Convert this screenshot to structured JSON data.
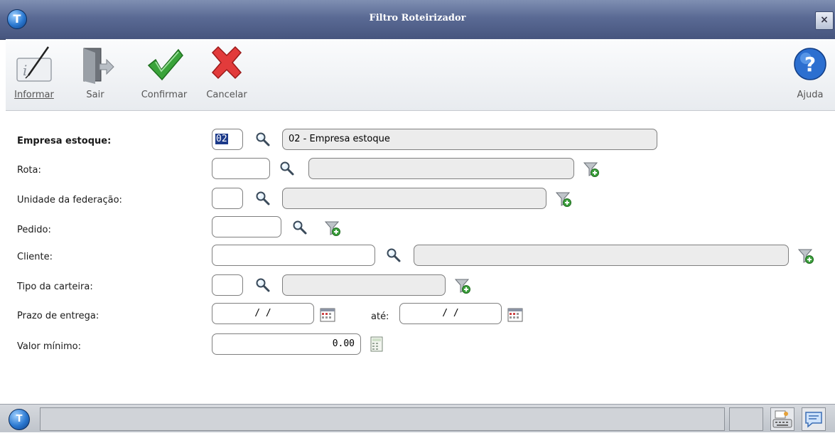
{
  "window": {
    "title": "Filtro Roteirizador",
    "close_glyph": "×"
  },
  "toolbar": {
    "informar": "Informar",
    "sair": "Sair",
    "confirmar": "Confirmar",
    "cancelar": "Cancelar",
    "ajuda": "Ajuda"
  },
  "form": {
    "empresa": {
      "label": "Empresa estoque:",
      "code": "02",
      "description": "02 - Empresa estoque"
    },
    "rota": {
      "label": "Rota:",
      "code": "",
      "description": ""
    },
    "uf": {
      "label": "Unidade da federação:",
      "code": "",
      "description": ""
    },
    "pedido": {
      "label": "Pedido:",
      "code": ""
    },
    "cliente": {
      "label": "Cliente:",
      "code": "",
      "description": ""
    },
    "tipo_carteira": {
      "label": "Tipo da carteira:",
      "code": "",
      "description": ""
    },
    "prazo": {
      "label": "Prazo de entrega:",
      "from": " / /",
      "to_label": "até:",
      "to": " / /"
    },
    "valor": {
      "label": "Valor mínimo:",
      "value": "0.00"
    }
  },
  "icons": {
    "lookup": "magnifier-icon",
    "filter": "filter-add-icon",
    "calendar": "calendar-icon",
    "calculator": "calculator-icon"
  },
  "colors": {
    "titlebar": "#5a6a94",
    "selection": "#1c3a8a",
    "readonly_bg": "#ececec"
  }
}
